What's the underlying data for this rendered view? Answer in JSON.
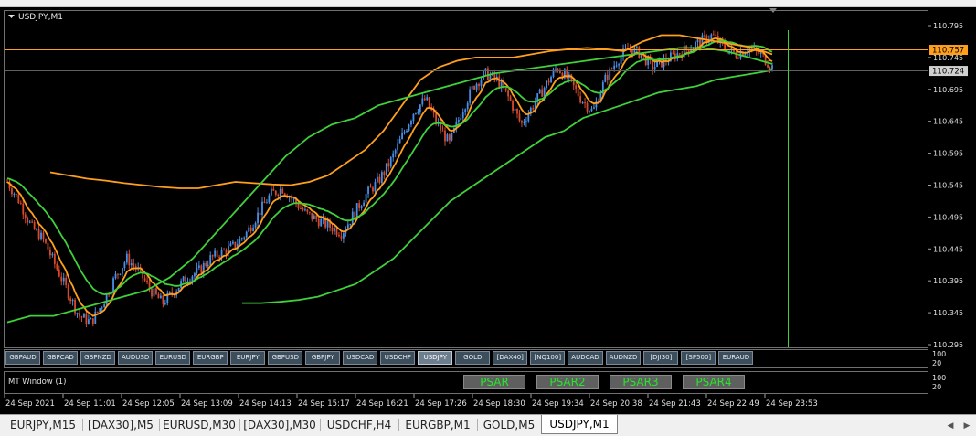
{
  "window": {
    "symbol_timeframe": "USDJPY,M1",
    "subwindow_label": "MT Window (1)"
  },
  "price_axis": {
    "ticks": [
      "110.795",
      "110.745",
      "110.695",
      "110.645",
      "110.595",
      "110.545",
      "110.495",
      "110.445",
      "110.395",
      "110.345",
      "110.295"
    ],
    "bid_price": "110.724",
    "hline_price": "110.757",
    "hline_value": 110.757,
    "bid_value": 110.724
  },
  "subwindow_axis": {
    "buttons_pane": [
      "100",
      "20"
    ],
    "indicator_pane": [
      "100",
      "20"
    ]
  },
  "time_axis": [
    "24 Sep 2021",
    "24 Sep 11:01",
    "24 Sep 12:05",
    "24 Sep 13:09",
    "24 Sep 14:13",
    "24 Sep 15:17",
    "24 Sep 16:21",
    "24 Sep 17:26",
    "24 Sep 18:30",
    "24 Sep 19:34",
    "24 Sep 20:38",
    "24 Sep 21:43",
    "24 Sep 22:49",
    "24 Sep 23:53"
  ],
  "symbol_buttons": [
    {
      "label": "GBPAUD"
    },
    {
      "label": "GBPCAD"
    },
    {
      "label": "GBPNZD"
    },
    {
      "label": "AUDUSD"
    },
    {
      "label": "EURUSD"
    },
    {
      "label": "EURGBP"
    },
    {
      "label": "EURJPY"
    },
    {
      "label": "GBPUSD"
    },
    {
      "label": "GBPJPY"
    },
    {
      "label": "USDCAD"
    },
    {
      "label": "USDCHF"
    },
    {
      "label": "USDJPY",
      "active": true
    },
    {
      "label": "GOLD"
    },
    {
      "label": "[DAX40]"
    },
    {
      "label": "[NQ100]"
    },
    {
      "label": "AUDCAD"
    },
    {
      "label": "AUDNZD"
    },
    {
      "label": "[DJI30]"
    },
    {
      "label": "[SP500]"
    },
    {
      "label": "EURAUD"
    }
  ],
  "psar_buttons": [
    "PSAR",
    "PSAR2",
    "PSAR3",
    "PSAR4"
  ],
  "tabs": [
    {
      "label": "EURJPY,M15"
    },
    {
      "label": "[DAX30],M5"
    },
    {
      "label": "EURUSD,M30"
    },
    {
      "label": "[DAX30],M30"
    },
    {
      "label": "USDCHF,H4"
    },
    {
      "label": "EURGBP,M1"
    },
    {
      "label": "GOLD,M5"
    },
    {
      "label": "USDJPY,M1",
      "active": true
    }
  ],
  "colors": {
    "background": "#000000",
    "bull_candle": "#4a8fe7",
    "bear_candle": "#d94a2c",
    "ma_orange": "#ff9f1c",
    "ma_green": "#3fd13a",
    "hline": "#ff9f1c",
    "vline": "#3fd13a",
    "psar_text": "#26e62a"
  },
  "icons": {
    "menu_arrow": "triangle-down-icon",
    "scroll_left": "arrow-left-icon",
    "scroll_right": "arrow-right-icon"
  },
  "chart_data": {
    "type": "line",
    "ylim": [
      110.295,
      110.795
    ],
    "series": [
      {
        "values": [
          110.55,
          110.52,
          110.48,
          110.46,
          110.42,
          110.38,
          110.34,
          110.33,
          110.36,
          110.4,
          110.43,
          110.41,
          110.38,
          110.36,
          110.38,
          110.4,
          110.41,
          110.43,
          110.44,
          110.45,
          110.47,
          110.5,
          110.53,
          110.54,
          110.52,
          110.5,
          110.49,
          110.48,
          110.47,
          110.5,
          110.53,
          110.55,
          110.58,
          110.62,
          110.66,
          110.68,
          110.64,
          110.61,
          110.66,
          110.7,
          110.72,
          110.71,
          110.68,
          110.64,
          110.67,
          110.7,
          110.73,
          110.71,
          110.68,
          110.66,
          110.71,
          110.74,
          110.76,
          110.75,
          110.73,
          110.74,
          110.75,
          110.76,
          110.77,
          110.78,
          110.76,
          110.75,
          110.76,
          110.75,
          110.73
        ]
      },
      {
        "values": [
          110.565,
          110.56,
          110.555,
          110.552,
          110.548,
          110.545,
          110.542,
          110.54,
          110.54,
          110.545,
          110.55,
          110.548,
          110.546,
          110.545,
          110.55,
          110.56,
          110.58,
          110.6,
          110.63,
          110.67,
          110.71,
          110.73,
          110.74,
          110.745,
          110.745,
          110.745,
          110.75,
          110.755,
          110.758,
          110.76,
          110.758,
          110.755,
          110.77,
          110.78,
          110.78,
          110.775,
          110.77,
          110.765,
          110.76,
          110.75
        ]
      },
      {
        "values": [
          110.33,
          110.34,
          110.34,
          110.35,
          110.36,
          110.37,
          110.38,
          110.4,
          110.43,
          110.47,
          110.51,
          110.55,
          110.59,
          110.62,
          110.64,
          110.65,
          110.67,
          110.68,
          110.69,
          110.7,
          110.71,
          110.72,
          110.725,
          110.73,
          110.735,
          110.74,
          110.745,
          110.75,
          110.755,
          110.76,
          110.76,
          110.755,
          110.745,
          110.735
        ]
      },
      {
        "values": [
          110.36,
          110.36,
          110.362,
          110.365,
          110.37,
          110.38,
          110.39,
          110.41,
          110.43,
          110.46,
          110.49,
          110.52,
          110.54,
          110.56,
          110.58,
          110.6,
          110.62,
          110.63,
          110.65,
          110.66,
          110.67,
          110.68,
          110.69,
          110.695,
          110.7,
          110.71,
          110.715,
          110.72,
          110.725
        ]
      }
    ]
  }
}
